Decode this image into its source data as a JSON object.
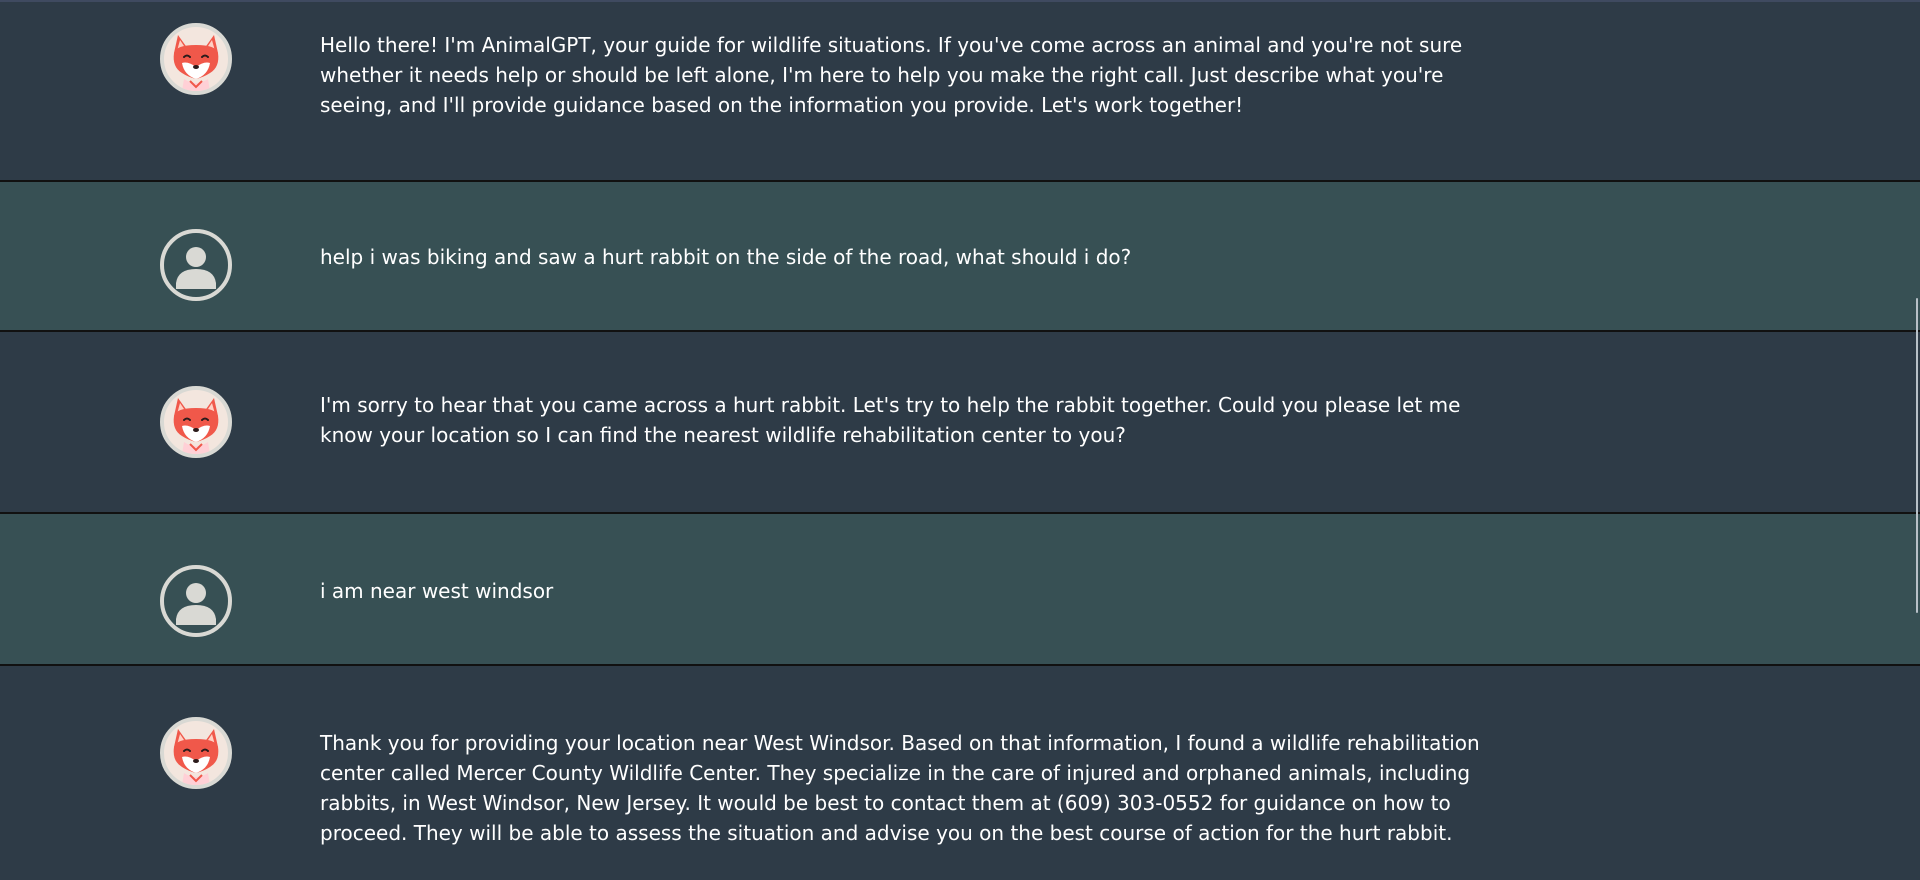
{
  "messages": [
    {
      "role": "assistant",
      "avatar_icon": "fox-avatar-icon",
      "text": "Hello there! I'm AnimalGPT, your guide for wildlife situations. If you've come across an animal and you're not sure whether it needs help or should be left alone, I'm here to help you make the right call. Just describe what you're seeing, and I'll provide guidance based on the information you provide. Let's work together!"
    },
    {
      "role": "user",
      "avatar_icon": "user-avatar-icon",
      "text": "help i was biking and saw a hurt rabbit on the side of the road, what should i do?"
    },
    {
      "role": "assistant",
      "avatar_icon": "fox-avatar-icon",
      "text": "I'm sorry to hear that you came across a hurt rabbit. Let's try to help the rabbit together. Could you please let me know your location so I can find the nearest wildlife rehabilitation center to you?"
    },
    {
      "role": "user",
      "avatar_icon": "user-avatar-icon",
      "text": "i am near west windsor"
    },
    {
      "role": "assistant",
      "avatar_icon": "fox-avatar-icon",
      "text": "Thank you for providing your location near West Windsor. Based on that information, I found a wildlife rehabilitation center called Mercer County Wildlife Center. They specialize in the care of injured and orphaned animals, including rabbits, in West Windsor, New Jersey. It would be best to contact them at (609) 303-0552 for guidance on how to proceed. They will be able to assess the situation and advise you on the best course of action for the hurt rabbit."
    }
  ],
  "colors": {
    "assistant_bg": "#2e3b47",
    "user_bg": "#375054",
    "text": "#ffffff",
    "avatar_ring": "#d9d9d4",
    "fox_orange": "#f0584a"
  }
}
